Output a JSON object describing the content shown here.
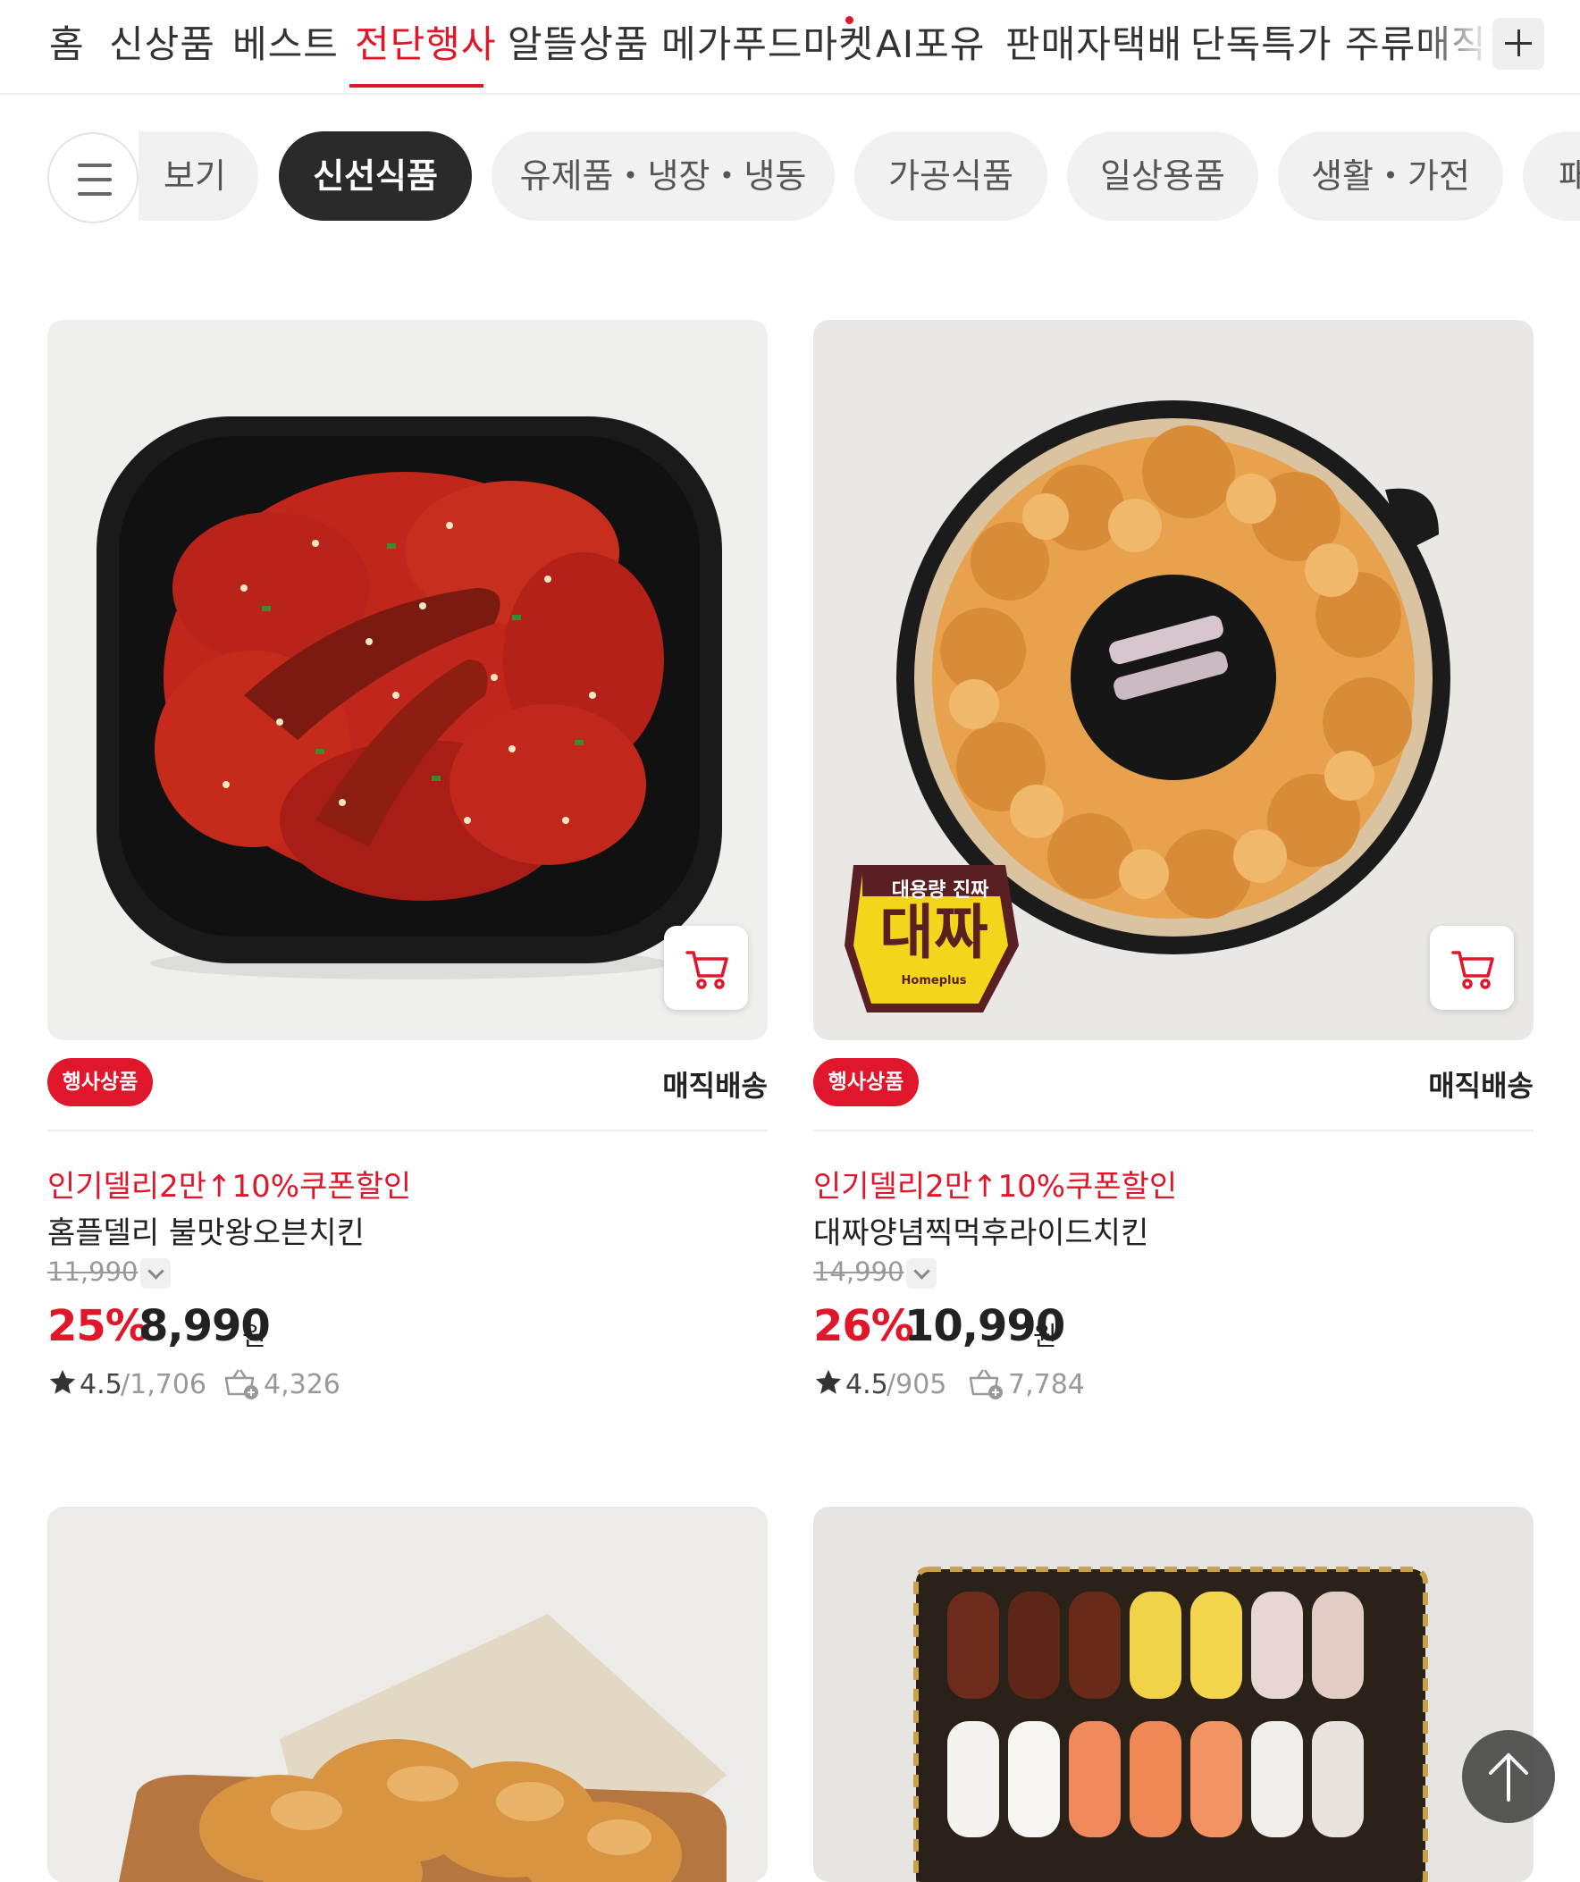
{
  "top_tabs": [
    {
      "label": "홈"
    },
    {
      "label": "신상품"
    },
    {
      "label": "베스트"
    },
    {
      "label": "전단행사"
    },
    {
      "label": "알뜰상품"
    },
    {
      "label": "메가푸드마켓"
    },
    {
      "label": "AI포유"
    },
    {
      "label": "판매자택배"
    },
    {
      "label": "단독특가"
    },
    {
      "label": "주류매직픽"
    }
  ],
  "active_tab": "전단행사",
  "category_chips": [
    {
      "label": "보기"
    },
    {
      "label": "신선식품"
    },
    {
      "label": "유제품・냉장・냉동"
    },
    {
      "label": "가공식품"
    },
    {
      "label": "일상용품"
    },
    {
      "label": "생활・가전"
    },
    {
      "label": "패"
    }
  ],
  "active_chip": "신선식품",
  "products": [
    {
      "badge": "행사상품",
      "delivery": "매직배송",
      "promo": "인기델리2만↑10%쿠폰할인",
      "name": "홈플델리 불맛왕오븐치킨",
      "original_price": "11,990",
      "discount": "25%",
      "price": "8,990",
      "currency": "원",
      "rating": "4.5",
      "reviews": "/1,706",
      "purchases": "4,326"
    },
    {
      "badge": "행사상품",
      "delivery": "매직배송",
      "promo": "인기델리2만↑10%쿠폰할인",
      "name": "대짜양념찍먹후라이드치킨",
      "original_price": "14,990",
      "discount": "26%",
      "price": "10,990",
      "currency": "원",
      "rating": "4.5",
      "reviews": "/905",
      "purchases": "7,784",
      "image_sticker": {
        "top": "대용량 진짜",
        "main": "대짜",
        "brand": "Homeplus"
      }
    }
  ],
  "colors": {
    "accent": "#e0162b",
    "chip_active": "#2a2a2a",
    "chip_bg": "#f1f1f1"
  }
}
